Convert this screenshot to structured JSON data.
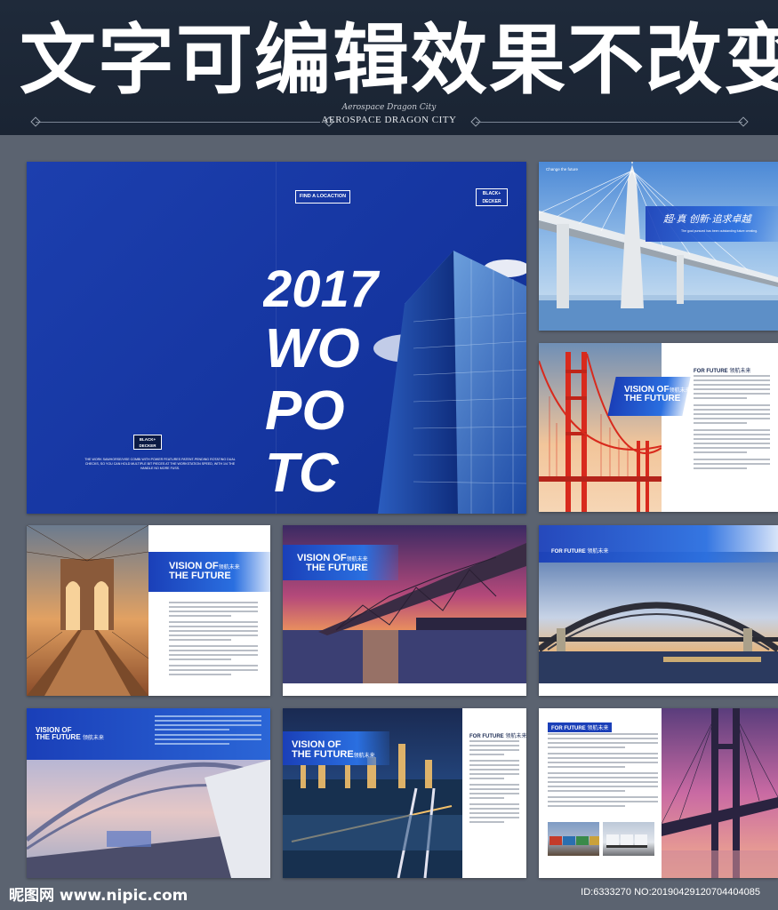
{
  "header": {
    "headline": "文字可编辑效果不改变",
    "brand_script": "Aerospace Dragon City",
    "brand": "AEROSPACE DRAGON CITY"
  },
  "cover": {
    "button": "FIND A LOCACTION",
    "logo_top": "BLACK+ DECKER",
    "logo_small": "BLACK+ DECKER",
    "year": "2017",
    "big_words": [
      "WO",
      "PO",
      "TC"
    ],
    "body_text": "THE WORK SAWHORSE/VISE COMBI WITH POWER FEATURES PATENT-PENDING ROTATING DUAL CHECKS, SO YOU CAN HOLD MULTIPLE BIT PIECES AT THE WORKSTATION SPEED, WITH 1/4 THE HANDLE NO MORE FUSS."
  },
  "bridge_top": {
    "tag": "Change the future",
    "slogan": "超·真  创新·追求卓越",
    "sub": "The goal pursued has been outstanding future creating."
  },
  "vision": {
    "line1": "VISION OF",
    "line2": "THE FUTURE",
    "cn": "领航未来"
  },
  "for_future": {
    "en": "FOR FUTURE",
    "cn": "领航未来"
  },
  "footer": {
    "logo": "昵图网 www.nipic.com",
    "id": "ID:6333270 NO:20190429120704404085"
  },
  "colors": {
    "accent": "#1a3fb8",
    "background": "#5b6370",
    "header": "#1f2a3a"
  }
}
